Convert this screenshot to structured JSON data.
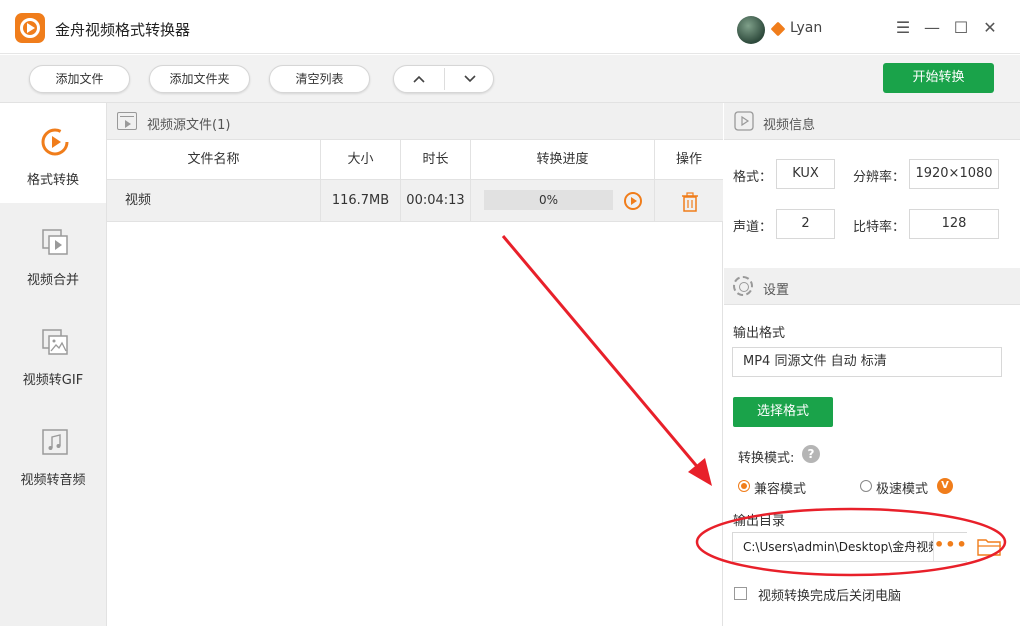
{
  "app": {
    "title": "金舟视频格式转换器",
    "username": "Lyan",
    "window_controls": [
      "menu-icon",
      "minimize-icon",
      "maximize-icon",
      "close-icon"
    ]
  },
  "toolbar": {
    "add_file": "添加文件",
    "add_folder": "添加文件夹",
    "clear_list": "清空列表",
    "move_up": "︿",
    "move_down": "﹀",
    "start": "开始转换"
  },
  "nav": [
    {
      "label": "格式转换",
      "icon": "format-convert-icon",
      "active": true
    },
    {
      "label": "视频合并",
      "icon": "video-merge-icon",
      "active": false
    },
    {
      "label": "视频转GIF",
      "icon": "video-to-gif-icon",
      "active": false
    },
    {
      "label": "视频转音频",
      "icon": "video-to-audio-icon",
      "active": false
    }
  ],
  "source": {
    "header": "视频源文件(1)",
    "columns": [
      "文件名称",
      "大小",
      "时长",
      "转换进度",
      "操作"
    ],
    "rows": [
      {
        "name": "视频",
        "size": "116.7MB",
        "duration": "00:04:13",
        "progress": "0%",
        "progress_fraction": 0
      }
    ]
  },
  "video_info": {
    "header": "视频信息",
    "format_label": "格式：",
    "format": "KUX",
    "resolution_label": "分辨率：",
    "resolution": "1920×1080",
    "channel_label": "声道：",
    "channel": "2",
    "bitrate_label": "比特率：",
    "bitrate": "128"
  },
  "settings": {
    "header": "设置",
    "output_format_label": "输出格式",
    "output_format": "MP4 同源文件 自动 标清",
    "choose_format": "选择格式",
    "mode_label": "转换模式:",
    "mode_compat": "兼容模式",
    "mode_fast": "极速模式",
    "vip_badge": "V",
    "output_dir_label": "输出目录",
    "output_dir": "C:\\Users\\admin\\Desktop\\金舟视频格式转换器",
    "browse_dots": "•••",
    "shutdown_label": "视频转换完成后关闭电脑"
  },
  "colors": {
    "accent": "#f07d1b",
    "primary_green": "#1aa34a",
    "annotation_red": "#e8202a"
  }
}
